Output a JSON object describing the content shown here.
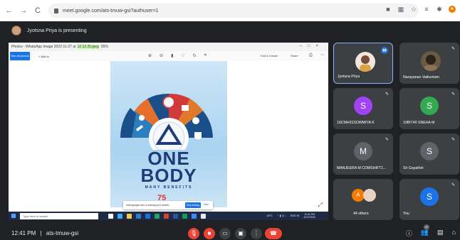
{
  "browser": {
    "url": "meet.google.com/ats-tmuw-gsi?authuser=1",
    "back": "←",
    "forward": "→",
    "reload": "C"
  },
  "presenting": {
    "text": "Jyotsna Priya is presenting"
  },
  "shared_window": {
    "title_prefix": "Photos - WhatsApp Image 2022-11-27 at ",
    "title_highlight": "12.12.35.jpeg",
    "title_zoom": "55%",
    "see_all": "See all photos",
    "add_to": "+  Add to",
    "edit_create": "Edit & Create",
    "share": "Share",
    "poster": {
      "one": "ONE",
      "body": "BODY",
      "many": "MANY BENEFITS",
      "seventy": "75"
    },
    "share_notice": "meet.google.com is sharing your screen.",
    "stop_sharing": "Stop sharing",
    "hide": "Hide",
    "taskbar_search": "Type here to search",
    "tray_temp": "30°C",
    "tray_clock_time": "12:41 PM",
    "tray_clock_date": "11/27/2022",
    "tray_lang": "ENG IN"
  },
  "participants": [
    {
      "name": "Jyotsna Priya",
      "type": "photo",
      "active": true
    },
    {
      "name": "Narayanan Vaikuntam",
      "type": "photo"
    },
    {
      "name": "19CMH31SOWMIYA K",
      "type": "letter",
      "letter": "S",
      "color": "#a142f4"
    },
    {
      "name": "19BIT40 SNEHA M",
      "type": "letter",
      "letter": "S",
      "color": "#34a853"
    },
    {
      "name": "MANJEERA M COMSHIFT1...",
      "type": "letter",
      "letter": "M",
      "color": "#5f6368"
    },
    {
      "name": "Sri Gayathiri",
      "type": "letter",
      "letter": "S",
      "color": "#5f6368"
    },
    {
      "name": "44 others",
      "type": "group",
      "letter": "A",
      "color": "#f57c00"
    },
    {
      "name": "You",
      "type": "letter",
      "letter": "S",
      "color": "#1a73e8"
    }
  ],
  "bottom": {
    "time": "12:41 PM",
    "separator": "|",
    "meeting_code": "ats-tmuw-gsi",
    "people_count": "47"
  },
  "colors": {
    "meet_bg": "#202124",
    "tile_bg": "#3c4043",
    "danger": "#ea4335",
    "accent": "#1a73e8"
  }
}
